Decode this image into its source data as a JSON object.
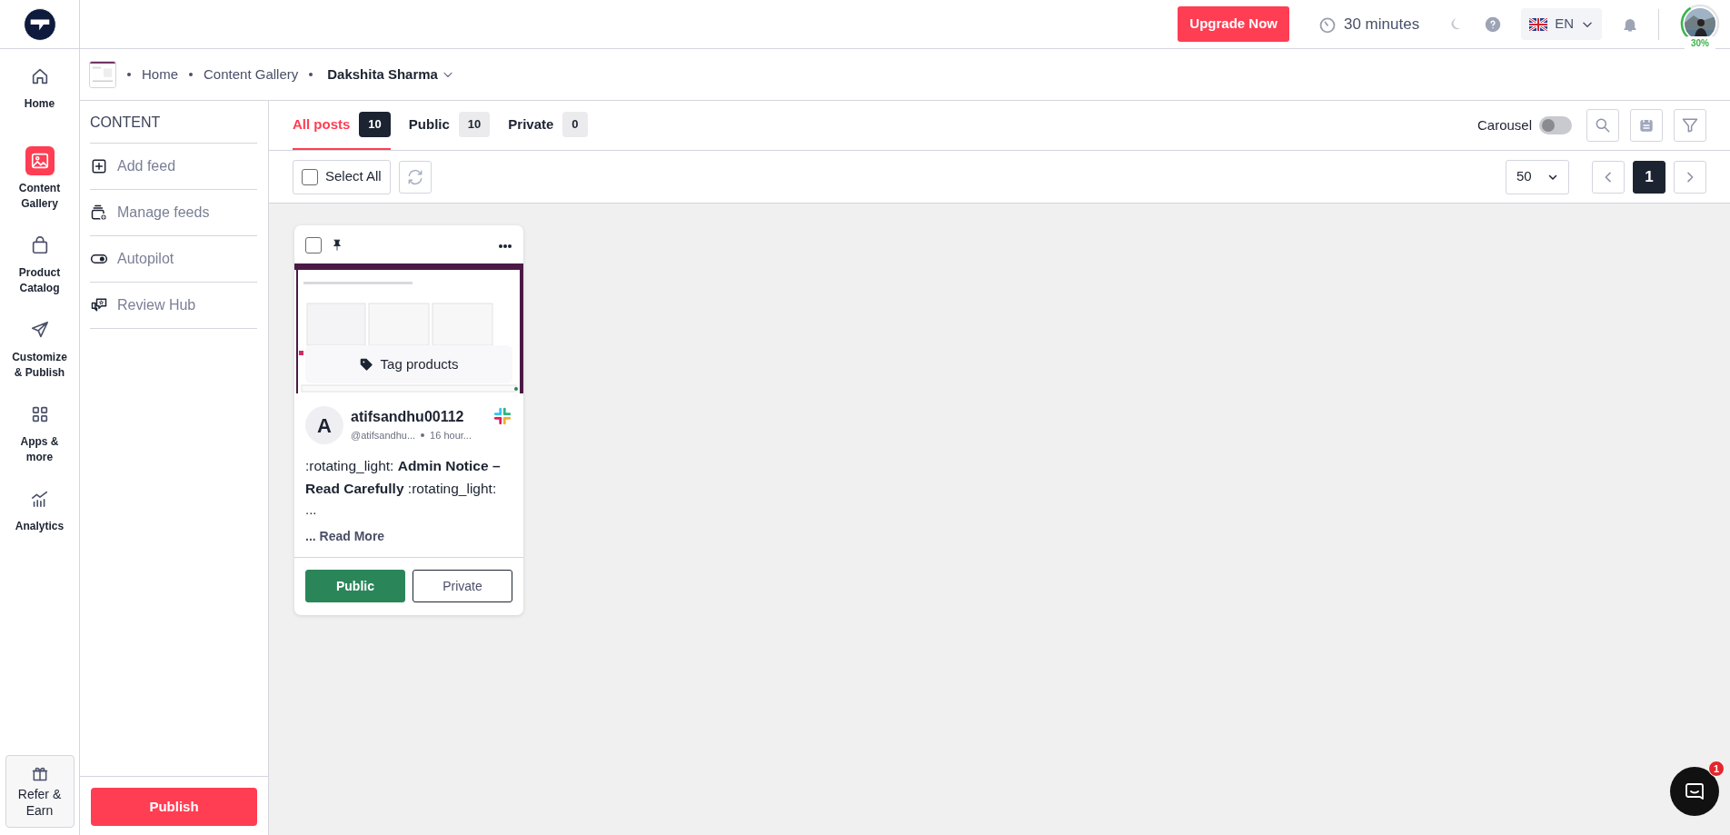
{
  "top_bar": {
    "upgrade_button": "Upgrade Now",
    "timer": "30 minutes",
    "language": "EN",
    "profile": {
      "level": 0.3,
      "progress": "30%"
    }
  },
  "nav_rail": {
    "items": [
      {
        "label": "Home",
        "selected": false
      },
      {
        "label": "Content Gallery",
        "selected": true
      },
      {
        "label": "Product Catalog",
        "selected": false
      },
      {
        "label": "Customize & Publish",
        "selected": false
      },
      {
        "label": "Apps & more",
        "selected": false
      },
      {
        "label": "Analytics",
        "selected": false
      }
    ],
    "refer_button": "Refer & Earn"
  },
  "breadcrumb": [
    "Home",
    "Content Gallery",
    "Dakshita Sharma"
  ],
  "content_menu": {
    "title": "CONTENT",
    "items": [
      "Add feed",
      "Manage feeds",
      "Autopilot",
      "Review Hub"
    ],
    "publish_button": "Publish"
  },
  "tabs": [
    {
      "label": "All posts",
      "count": "10",
      "selected": true
    },
    {
      "label": "Public",
      "count": "10",
      "selected": false
    },
    {
      "label": "Private",
      "count": "0",
      "selected": false
    }
  ],
  "carousel": {
    "label": "Carousel",
    "on": false
  },
  "select_all": {
    "label": "Select All",
    "checked": false
  },
  "page_size": "50",
  "pages": [
    {
      "label": "1",
      "selected": true
    }
  ],
  "posts": [
    {
      "checked": false,
      "overlay_button": "Tag products",
      "avatar": "A",
      "author": "atifsandhu00112",
      "handle": "@atifsandhu...",
      "time": "16 hour...",
      "text": ":rotating_light: **Admin Notice – Read Carefully** :rotating_light:",
      "text_more": "...",
      "read_more": "... Read More",
      "actions": [
        {
          "label": "Public",
          "selected": true
        },
        {
          "label": "Private",
          "selected": false
        }
      ]
    }
  ],
  "chat": {
    "badge": "1"
  }
}
